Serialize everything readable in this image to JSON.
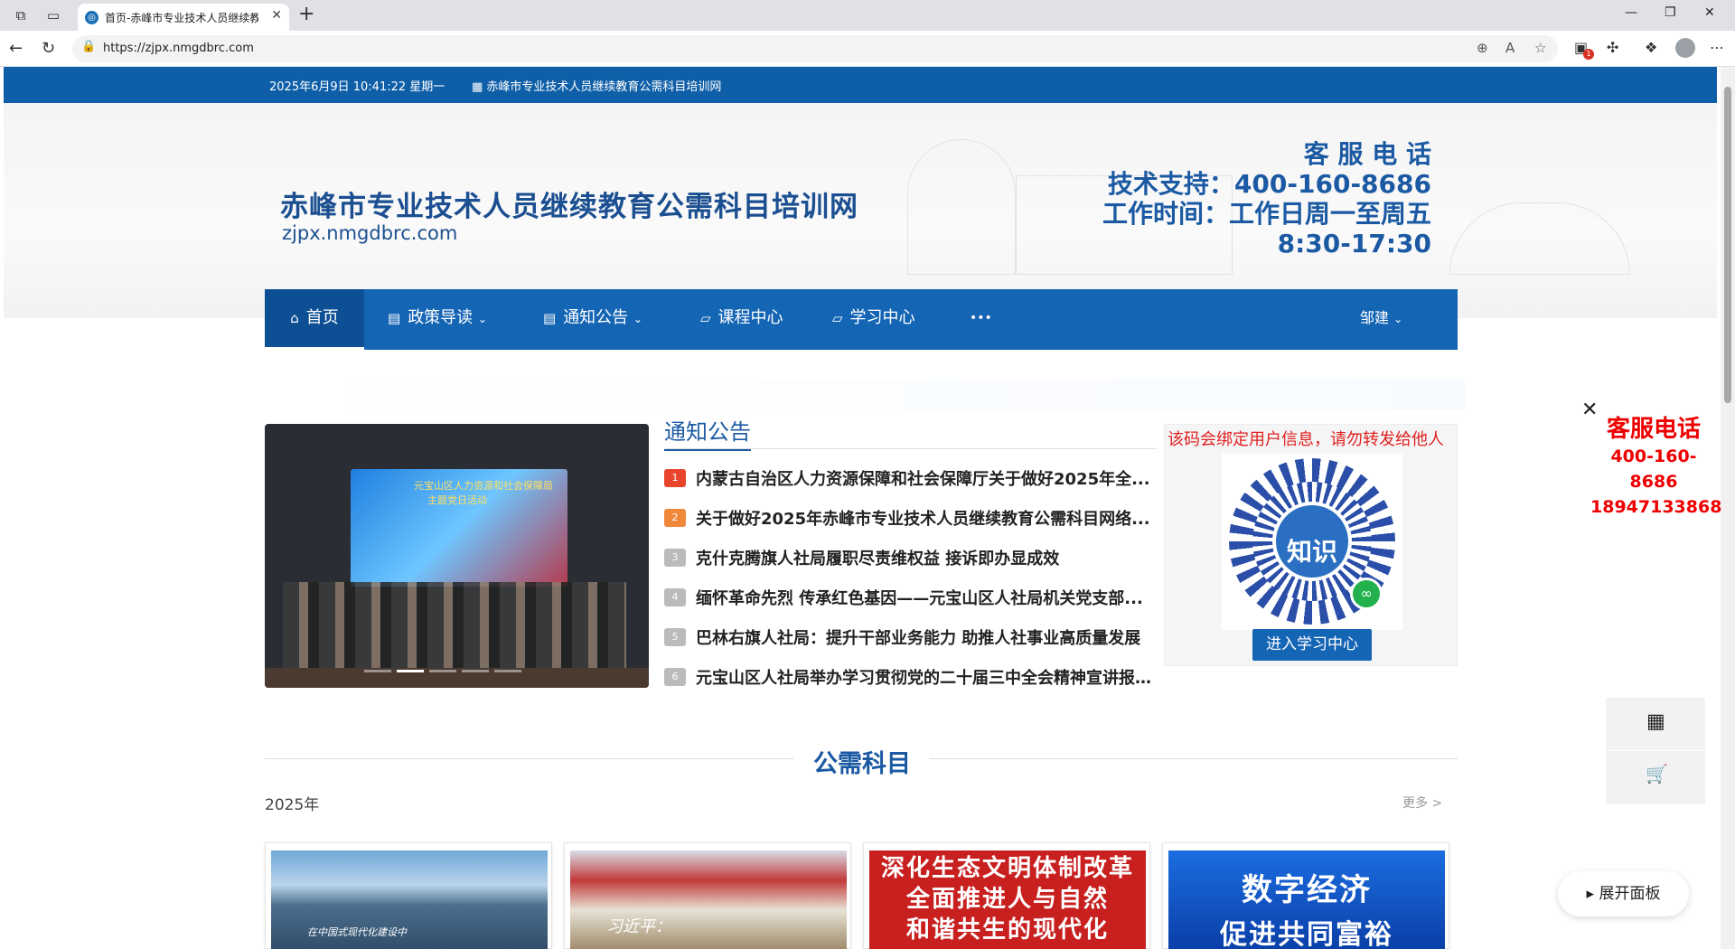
{
  "browser": {
    "tab_title": "首页-赤峰市专业技术人员继续教育公需科目培训网",
    "url": "https://zjpx.nmgdbrc.com",
    "notification_count": "1"
  },
  "topbar": {
    "datetime": "2025年6月9日 10:41:22 星期一",
    "site_link": "赤峰市专业技术人员继续教育公需科目培训网"
  },
  "header": {
    "title": "赤峰市专业技术人员继续教育公需科目培训网",
    "domain": "zjpx.nmgdbrc.com",
    "contact_title": "客 服 电 话",
    "support": "技术支持：400-160-8686",
    "hours": "工作时间：工作日周一至周五",
    "hours_time": "8:30-17:30"
  },
  "nav": {
    "home": "首页",
    "policy": "政策导读",
    "notice": "通知公告",
    "courses": "课程中心",
    "study": "学习中心",
    "more": "•••",
    "user": "邹建"
  },
  "slider": {
    "screen_line1": "元宝山区人力资源和社会保障局",
    "screen_line2": "主题党日活动"
  },
  "notices": {
    "heading": "通知公告",
    "items": [
      {
        "num": "1",
        "text": "内蒙古自治区人力资源保障和社会保障厅关于做好2025年全...",
        "color": "#e8452c"
      },
      {
        "num": "2",
        "text": "关于做好2025年赤峰市专业技术人员继续教育公需科目网络...",
        "color": "#f0883a"
      },
      {
        "num": "3",
        "text": "克什克腾旗人社局履职尽责维权益 接诉即办显成效",
        "color": "#bbbbbb"
      },
      {
        "num": "4",
        "text": "缅怀革命先烈 传承红色基因——元宝山区人社局机关党支部...",
        "color": "#bbbbbb"
      },
      {
        "num": "5",
        "text": "巴林右旗人社局：提升干部业务能力 助推人社事业高质量发展",
        "color": "#bbbbbb"
      },
      {
        "num": "6",
        "text": "元宝山区人社局举办学习贯彻党的二十届三中全会精神宣讲报...",
        "color": "#bbbbbb"
      }
    ]
  },
  "qr": {
    "warning": "该码会绑定用户信息，请勿转发给他人",
    "center_text": "知识",
    "button": "进入学习中心"
  },
  "float": {
    "phone_title": "客服电话",
    "phone1": "400-160-8686",
    "phone2": "18947133868",
    "expand": "展开面板"
  },
  "section": {
    "title": "公需科目",
    "year": "2025年",
    "more": "更多 >"
  },
  "cards": [
    {
      "caption": "",
      "sub": "在中国式现代化建设中"
    },
    {
      "caption": "",
      "sub": "习近平："
    },
    {
      "caption": "深化生态文明体制改革",
      "caption2": "全面推进人与自然",
      "caption3": "和谐共生的现代化"
    },
    {
      "caption": "数字经济",
      "caption2": "促进共同富裕"
    }
  ]
}
